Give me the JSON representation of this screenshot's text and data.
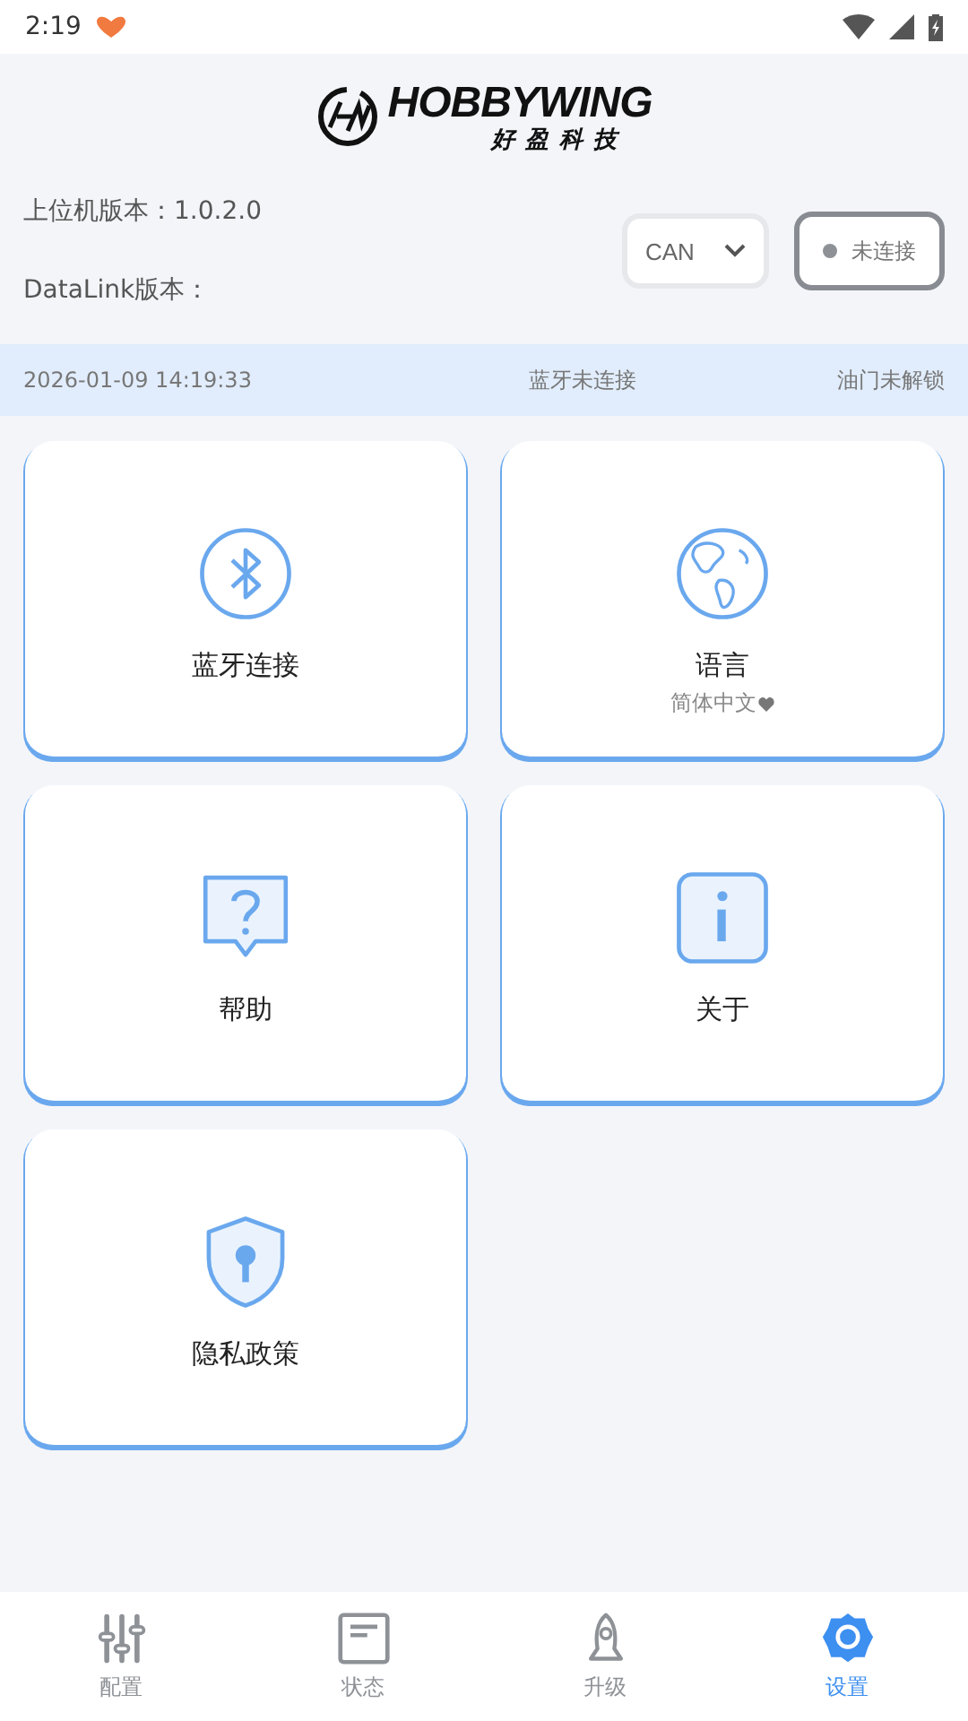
{
  "status_bar": {
    "time": "2:19"
  },
  "header": {
    "brand": "HOBBYWING",
    "brand_cn": "好盈科技",
    "app_version": "上位机版本：1.0.2.0",
    "datalink_version": "DataLink版本：",
    "protocol": "CAN",
    "connection": "未连接",
    "connected": false
  },
  "info_bar": {
    "datetime": "2026-01-09 14:19:33",
    "bluetooth": "蓝牙未连接",
    "throttle": "油门未解锁"
  },
  "cards": [
    {
      "kind": "bluetooth",
      "title": "蓝牙连接"
    },
    {
      "kind": "language",
      "title": "语言",
      "subtitle": "简体中文"
    },
    {
      "kind": "help",
      "title": "帮助"
    },
    {
      "kind": "about",
      "title": "关于"
    },
    {
      "kind": "privacy",
      "title": "隐私政策"
    }
  ],
  "tabs": [
    {
      "kind": "config",
      "label": "配置",
      "selected": false
    },
    {
      "kind": "status",
      "label": "状态",
      "selected": false
    },
    {
      "kind": "upgrade",
      "label": "升级",
      "selected": false
    },
    {
      "kind": "settings",
      "label": "设置",
      "selected": true
    }
  ]
}
